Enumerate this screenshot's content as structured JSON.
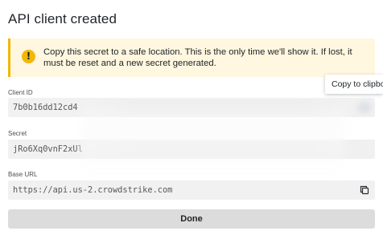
{
  "dialog": {
    "title": "API client created",
    "alert": {
      "icon": "warning-icon",
      "icon_glyph": "!",
      "message": "Copy this secret to a safe location. This is the only time we'll show it. If lost, it must be reset and a new secret generated."
    },
    "fields": {
      "client_id": {
        "label": "Client ID",
        "value": "7b0b16dd12cd4"
      },
      "secret": {
        "label": "Secret",
        "value": "jRo6Xq0vnF2xUl"
      },
      "base_url": {
        "label": "Base URL",
        "value": "https://api.us-2.crowdstrike.com",
        "copy_icon": "copy-icon"
      }
    },
    "tooltip": "Copy to clipboard",
    "done_label": "Done"
  },
  "colors": {
    "alert_background": "#fff7df",
    "alert_accent": "#f2b705",
    "field_background": "#f1f1f1",
    "button_background": "#dcdcdc"
  }
}
